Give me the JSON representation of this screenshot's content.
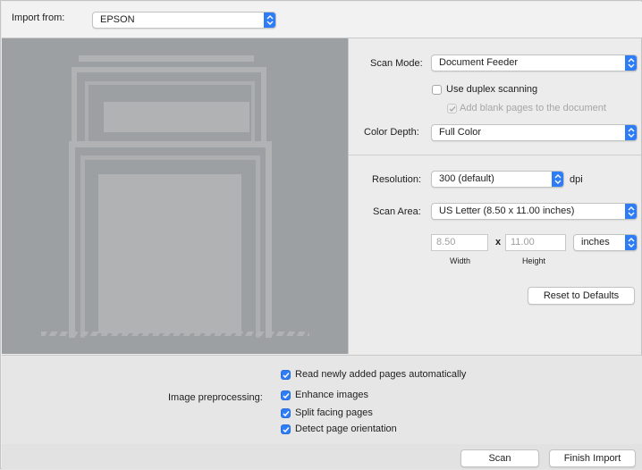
{
  "import": {
    "label": "Import from:",
    "device": "EPSON"
  },
  "settings": {
    "scan_mode_label": "Scan Mode:",
    "scan_mode_value": "Document Feeder",
    "duplex_label": "Use duplex scanning",
    "duplex_checked": false,
    "blank_pages_label": "Add blank pages to the document",
    "blank_pages_checked": true,
    "blank_pages_enabled": false,
    "color_depth_label": "Color Depth:",
    "color_depth_value": "Full Color",
    "resolution_label": "Resolution:",
    "resolution_value": "300 (default)",
    "resolution_unit": "dpi",
    "scan_area_label": "Scan Area:",
    "scan_area_value": "US Letter (8.50 x 11.00 inches)",
    "width_value": "8.50",
    "times_sign": "x",
    "height_value": "11.00",
    "units_value": "inches",
    "width_caption": "Width",
    "height_caption": "Height",
    "reset_button": "Reset to Defaults"
  },
  "preprocessing": {
    "label": "Image preprocessing:",
    "options": [
      {
        "label": "Read newly added pages automatically",
        "checked": true
      },
      {
        "label": "Enhance images",
        "checked": true
      },
      {
        "label": "Split facing pages",
        "checked": true
      },
      {
        "label": "Detect page orientation",
        "checked": true
      }
    ]
  },
  "actions": {
    "scan": "Scan",
    "finish": "Finish Import"
  },
  "colors": {
    "accent": "#2e7cf6",
    "preview_bg": "#9da0a2",
    "preview_shape": "#b0b2b4"
  },
  "icons": {
    "popup_arrows": "up-down-chevron-icon",
    "checkmark": "checkmark-icon"
  }
}
